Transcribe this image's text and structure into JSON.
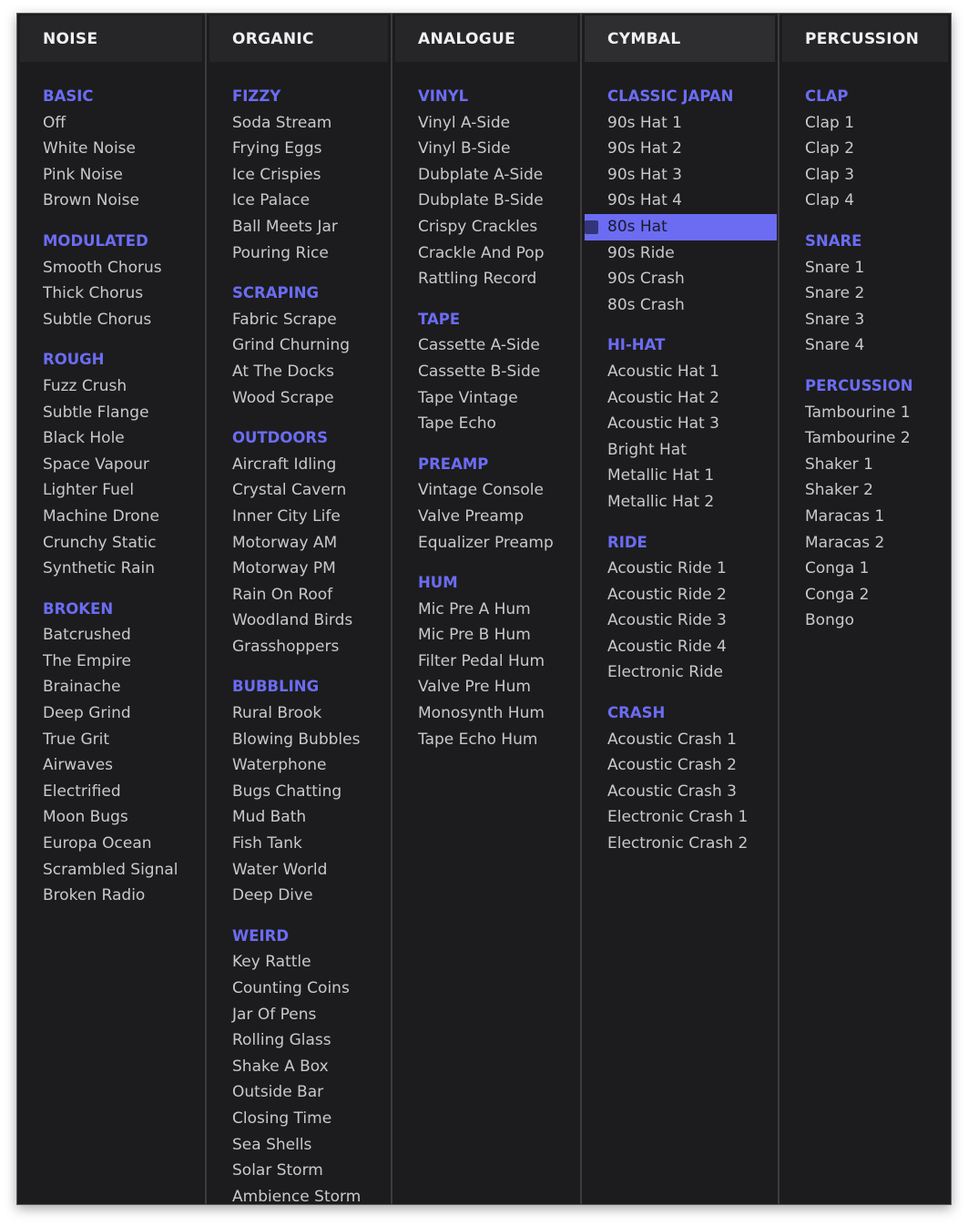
{
  "accent_color": "#6b6cf2",
  "selected": {
    "column": "CYMBAL",
    "item": "80s Hat"
  },
  "columns": [
    {
      "title": "NOISE",
      "groups": [
        {
          "title": "BASIC",
          "items": [
            "Off",
            "White Noise",
            "Pink Noise",
            "Brown Noise"
          ]
        },
        {
          "title": "MODULATED",
          "items": [
            "Smooth Chorus",
            "Thick Chorus",
            "Subtle Chorus"
          ]
        },
        {
          "title": "ROUGH",
          "items": [
            "Fuzz Crush",
            "Subtle Flange",
            "Black Hole",
            "Space Vapour",
            "Lighter Fuel",
            "Machine Drone",
            "Crunchy Static",
            "Synthetic Rain"
          ]
        },
        {
          "title": "BROKEN",
          "items": [
            "Batcrushed",
            "The Empire",
            "Brainache",
            "Deep Grind",
            "True Grit",
            "Airwaves",
            "Electrified",
            "Moon Bugs",
            "Europa Ocean",
            "Scrambled Signal",
            "Broken Radio"
          ]
        }
      ]
    },
    {
      "title": "ORGANIC",
      "groups": [
        {
          "title": "FIZZY",
          "items": [
            "Soda Stream",
            "Frying Eggs",
            "Ice Crispies",
            "Ice Palace",
            "Ball Meets Jar",
            "Pouring Rice"
          ]
        },
        {
          "title": "SCRAPING",
          "items": [
            "Fabric Scrape",
            "Grind Churning",
            "At The Docks",
            "Wood Scrape"
          ]
        },
        {
          "title": "OUTDOORS",
          "items": [
            "Aircraft Idling",
            "Crystal Cavern",
            "Inner City Life",
            "Motorway AM",
            "Motorway PM",
            "Rain On Roof",
            "Woodland Birds",
            "Grasshoppers"
          ]
        },
        {
          "title": "BUBBLING",
          "items": [
            "Rural Brook",
            "Blowing Bubbles",
            "Waterphone",
            "Bugs Chatting",
            "Mud Bath",
            "Fish Tank",
            "Water World",
            "Deep Dive"
          ]
        },
        {
          "title": "WEIRD",
          "items": [
            "Key Rattle",
            "Counting Coins",
            "Jar Of Pens",
            "Rolling Glass",
            "Shake A Box",
            "Outside Bar",
            "Closing Time",
            "Sea Shells",
            "Solar Storm",
            "Ambience Storm"
          ]
        }
      ]
    },
    {
      "title": "ANALOGUE",
      "groups": [
        {
          "title": "VINYL",
          "items": [
            "Vinyl A-Side",
            "Vinyl B-Side",
            "Dubplate A-Side",
            "Dubplate B-Side",
            "Crispy Crackles",
            "Crackle And Pop",
            "Rattling Record"
          ]
        },
        {
          "title": "TAPE",
          "items": [
            "Cassette A-Side",
            "Cassette B-Side",
            "Tape Vintage",
            "Tape Echo"
          ]
        },
        {
          "title": "PREAMP",
          "items": [
            "Vintage Console",
            "Valve Preamp",
            "Equalizer Preamp"
          ]
        },
        {
          "title": "HUM",
          "items": [
            "Mic Pre A Hum",
            "Mic Pre B Hum",
            "Filter Pedal Hum",
            "Valve Pre Hum",
            "Monosynth Hum",
            "Tape Echo Hum"
          ]
        }
      ]
    },
    {
      "title": "CYMBAL",
      "active": true,
      "groups": [
        {
          "title": "CLASSIC JAPAN",
          "items": [
            "90s Hat 1",
            "90s Hat 2",
            "90s Hat 3",
            "90s Hat 4",
            "80s Hat",
            "90s Ride",
            "90s Crash",
            "80s Crash"
          ]
        },
        {
          "title": "HI-HAT",
          "items": [
            "Acoustic Hat 1",
            "Acoustic Hat 2",
            "Acoustic Hat 3",
            "Bright Hat",
            "Metallic Hat 1",
            "Metallic Hat 2"
          ]
        },
        {
          "title": "RIDE",
          "items": [
            "Acoustic Ride 1",
            "Acoustic Ride 2",
            "Acoustic Ride 3",
            "Acoustic Ride 4",
            "Electronic Ride"
          ]
        },
        {
          "title": "CRASH",
          "items": [
            "Acoustic Crash 1",
            "Acoustic Crash 2",
            "Acoustic Crash 3",
            "Electronic Crash 1",
            "Electronic Crash 2"
          ]
        }
      ]
    },
    {
      "title": "PERCUSSION",
      "groups": [
        {
          "title": "CLAP",
          "items": [
            "Clap 1",
            "Clap 2",
            "Clap 3",
            "Clap 4"
          ]
        },
        {
          "title": "SNARE",
          "items": [
            "Snare 1",
            "Snare 2",
            "Snare 3",
            "Snare 4"
          ]
        },
        {
          "title": "PERCUSSION",
          "items": [
            "Tambourine 1",
            "Tambourine 2",
            "Shaker 1",
            "Shaker 2",
            "Maracas 1",
            "Maracas 2",
            "Conga 1",
            "Conga 2",
            "Bongo"
          ]
        }
      ]
    }
  ]
}
